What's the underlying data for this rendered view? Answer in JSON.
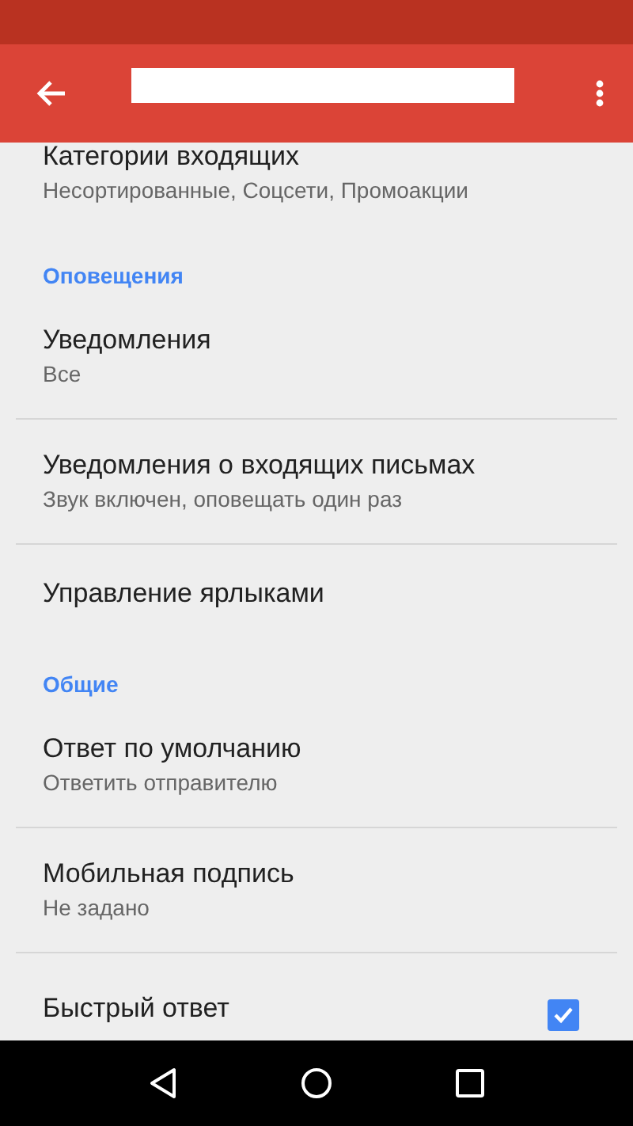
{
  "app_bar": {
    "redacted": true
  },
  "settings": [
    {
      "kind": "item",
      "title": "Категории входящих",
      "subtitle": "Несортированные, Соцсети, Промоакции"
    },
    {
      "kind": "header",
      "title": "Оповещения"
    },
    {
      "kind": "item",
      "title": "Уведомления",
      "subtitle": "Все"
    },
    {
      "kind": "item",
      "title": "Уведомления о входящих письмах",
      "subtitle": "Звук включен, оповещать один раз"
    },
    {
      "kind": "item",
      "title": "Управление ярлыками"
    },
    {
      "kind": "header",
      "title": "Общие"
    },
    {
      "kind": "item",
      "title": "Ответ по умолчанию",
      "subtitle": "Ответить отправителю"
    },
    {
      "kind": "item",
      "title": "Мобильная подпись",
      "subtitle": "Не задано"
    },
    {
      "kind": "checkbox",
      "title": "Быстрый ответ",
      "checked": true
    }
  ]
}
